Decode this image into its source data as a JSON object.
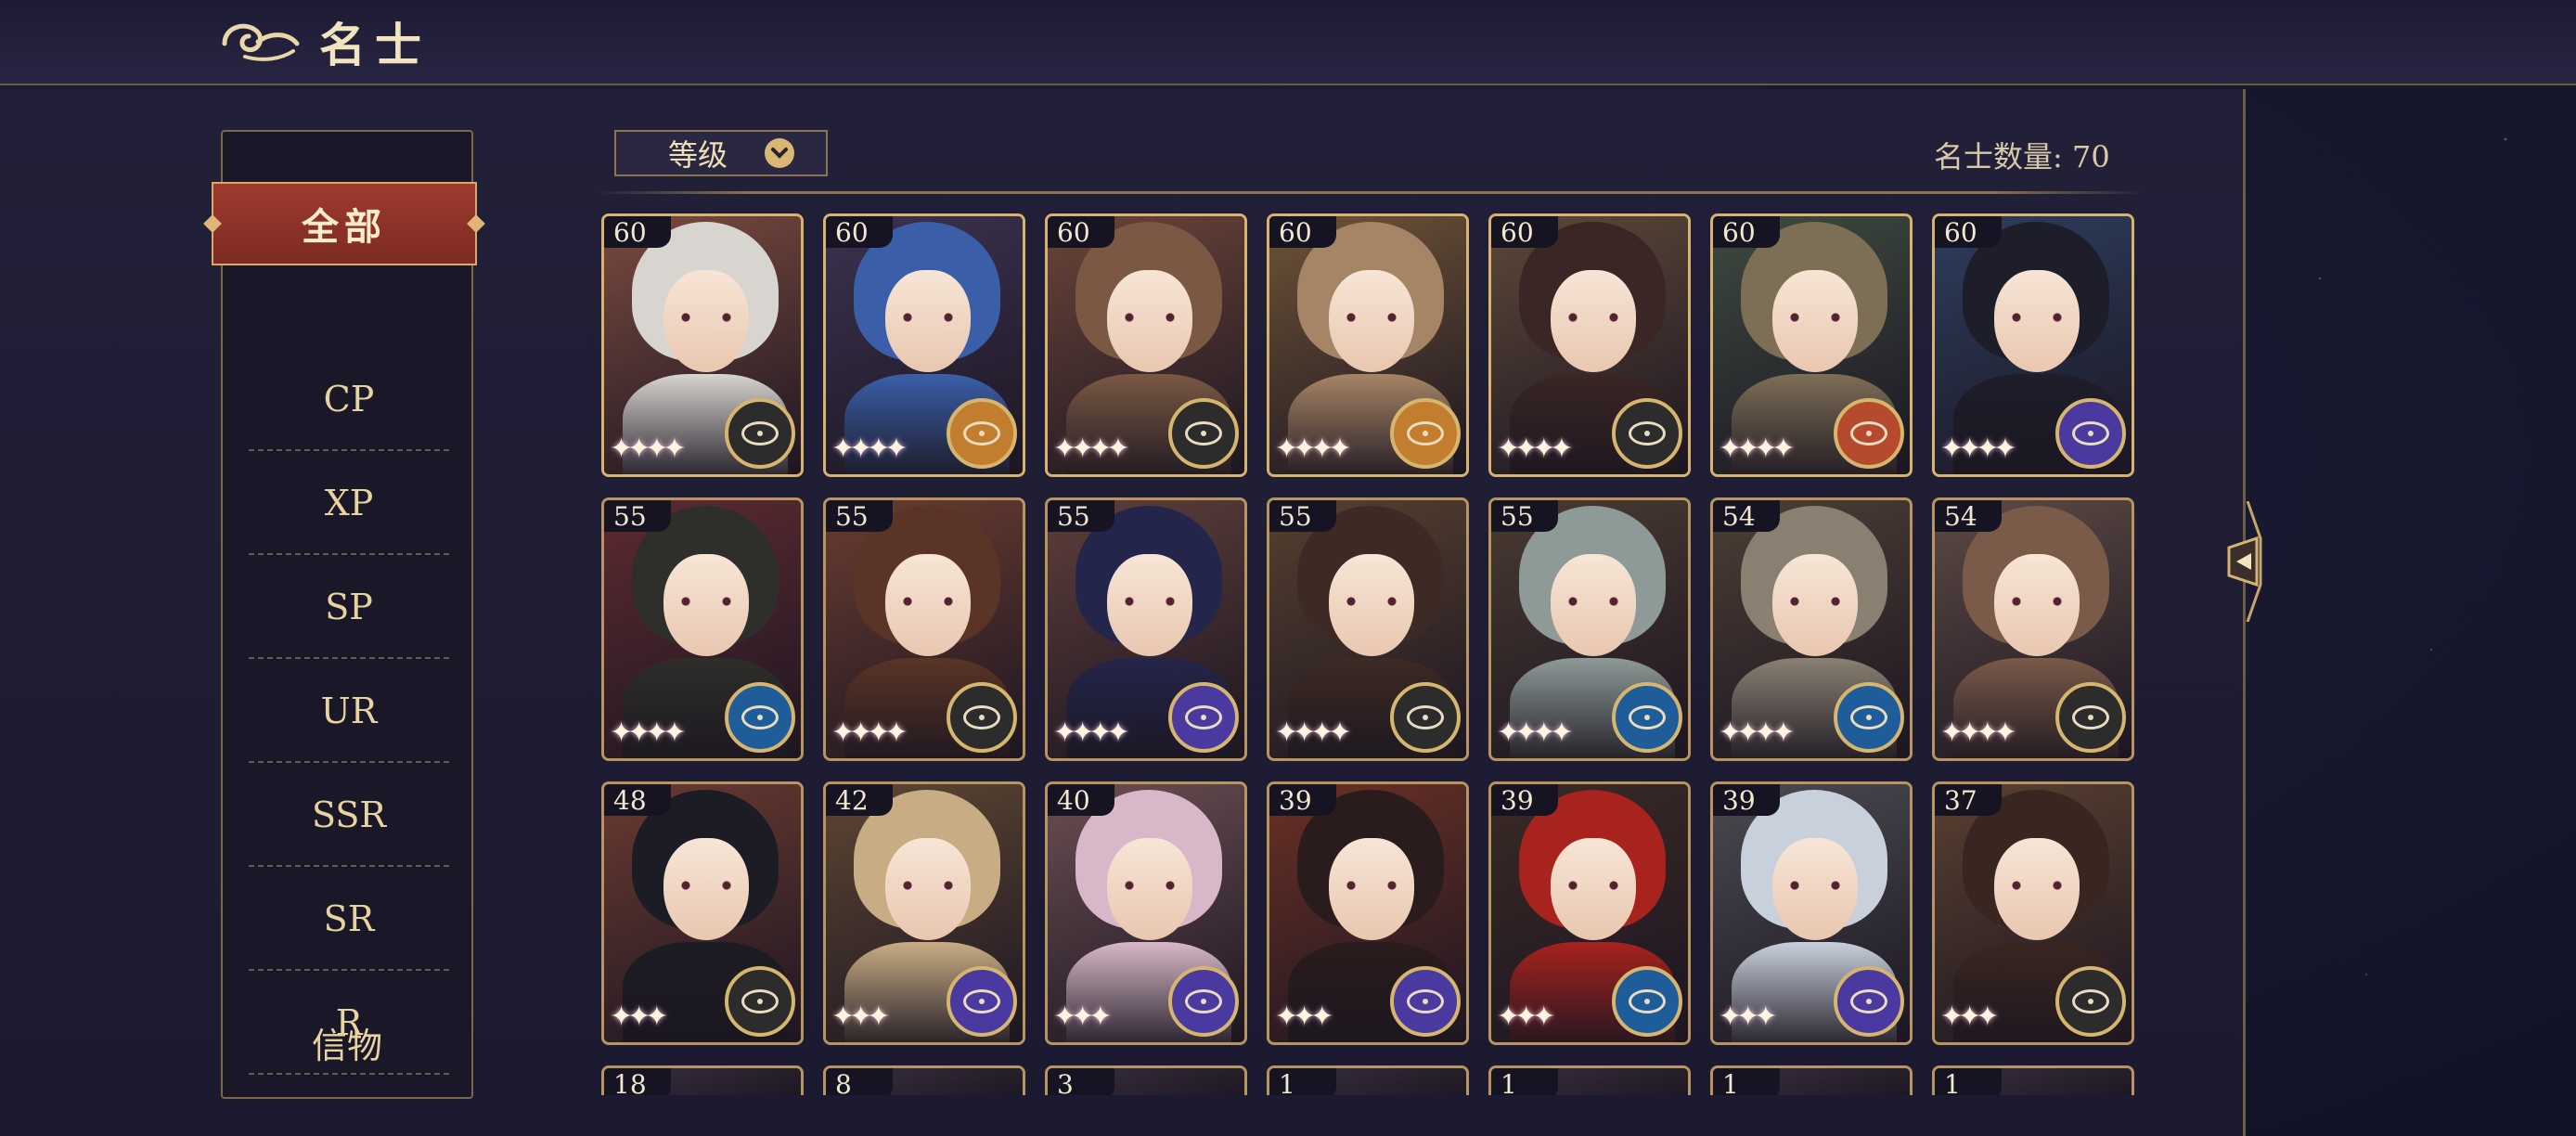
{
  "header": {
    "title": "名士"
  },
  "sidebar": {
    "active": "全部",
    "items": [
      {
        "label": "CP"
      },
      {
        "label": "XP"
      },
      {
        "label": "SP"
      },
      {
        "label": "UR"
      },
      {
        "label": "SSR"
      },
      {
        "label": "SR"
      },
      {
        "label": "R"
      },
      {
        "label": "信物"
      }
    ]
  },
  "toolbar": {
    "sort_label": "等级",
    "count_label": "名士数量: 70"
  },
  "cards": [
    {
      "level": "60",
      "hair": "#d8d4d0",
      "bg": "#7a4a3e",
      "badge": "#2c2c2c",
      "stars": "✦✦✦✦"
    },
    {
      "level": "60",
      "hair": "#3a5fa8",
      "bg": "#3b3350",
      "badge": "#c27d2f",
      "stars": "✦✦✦✦"
    },
    {
      "level": "60",
      "hair": "#7a5843",
      "bg": "#6b4438",
      "badge": "#2c2c2c",
      "stars": "✦✦✦✦"
    },
    {
      "level": "60",
      "hair": "#a68466",
      "bg": "#6e5336",
      "badge": "#c27d2f",
      "stars": "✦✦✦✦"
    },
    {
      "level": "60",
      "hair": "#3a2624",
      "bg": "#5d4838",
      "badge": "#2c2c2c",
      "stars": "✦✦✦✦"
    },
    {
      "level": "60",
      "hair": "#7d6e56",
      "bg": "#3d4a40",
      "badge": "#b54a2e",
      "stars": "✦✦✦✦"
    },
    {
      "level": "60",
      "hair": "#1e1d2a",
      "bg": "#2d3e5e",
      "badge": "#4a3aa0",
      "stars": "✦✦✦✦"
    },
    {
      "level": "55",
      "hair": "#2e2e2a",
      "bg": "#5e2a30",
      "badge": "#1f5d9a",
      "stars": "✦✦✦✦"
    },
    {
      "level": "55",
      "hair": "#5a3426",
      "bg": "#6a3c30",
      "badge": "#2c2c2c",
      "stars": "✦✦✦✦"
    },
    {
      "level": "55",
      "hair": "#24254a",
      "bg": "#5e3e3a",
      "badge": "#4a3aa0",
      "stars": "✦✦✦✦"
    },
    {
      "level": "55",
      "hair": "#3d2a24",
      "bg": "#56402f",
      "badge": "#2c2c2c",
      "stars": "✦✦✦✦"
    },
    {
      "level": "55",
      "hair": "#8e9a98",
      "bg": "#4a3a30",
      "badge": "#1f5d9a",
      "stars": "✦✦✦✦"
    },
    {
      "level": "54",
      "hair": "#8a8072",
      "bg": "#4d3e34",
      "badge": "#1f5d9a",
      "stars": "✦✦✦✦"
    },
    {
      "level": "54",
      "hair": "#7a5a48",
      "bg": "#5c4a44",
      "badge": "#2c2c2c",
      "stars": "✦✦✦✦"
    },
    {
      "level": "48",
      "hair": "#1c1c24",
      "bg": "#6a3a30",
      "badge": "#2c2c2c",
      "stars": "✦✦✦"
    },
    {
      "level": "42",
      "hair": "#c8ac84",
      "bg": "#5e4632",
      "badge": "#4a3aa0",
      "stars": "✦✦✦"
    },
    {
      "level": "40",
      "hair": "#d8b8c8",
      "bg": "#6a4e52",
      "badge": "#4a3aa0",
      "stars": "✦✦✦"
    },
    {
      "level": "39",
      "hair": "#2a1c1c",
      "bg": "#6a3024",
      "badge": "#4a3aa0",
      "stars": "✦✦✦"
    },
    {
      "level": "39",
      "hair": "#a8221e",
      "bg": "#3a2a24",
      "badge": "#1f5d9a",
      "stars": "✦✦✦"
    },
    {
      "level": "39",
      "hair": "#c8d0dc",
      "bg": "#4a4a50",
      "badge": "#4a3aa0",
      "stars": "✦✦✦"
    },
    {
      "level": "37",
      "hair": "#3a2620",
      "bg": "#5a4030",
      "badge": "#2c2c2c",
      "stars": "✦✦✦"
    },
    {
      "level": "18"
    },
    {
      "level": "8"
    },
    {
      "level": "3"
    },
    {
      "level": "1"
    },
    {
      "level": "1"
    },
    {
      "level": "1"
    },
    {
      "level": "1"
    }
  ]
}
